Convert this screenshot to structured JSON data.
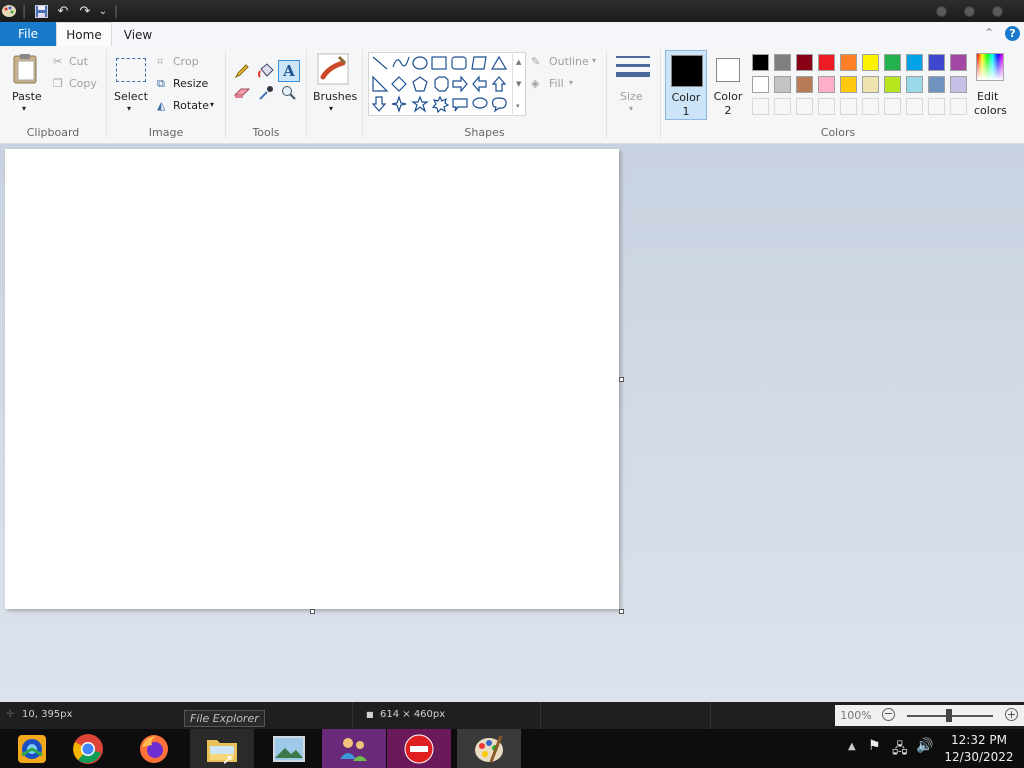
{
  "quick_access": {
    "undo_label": "↶",
    "redo_label": "↷",
    "more_label": "⌄"
  },
  "tabs": {
    "file": "File",
    "home": "Home",
    "view": "View"
  },
  "help_label": "?",
  "clipboard": {
    "paste": "Paste",
    "cut": "Cut",
    "copy": "Copy",
    "group": "Clipboard"
  },
  "image": {
    "select": "Select",
    "crop": "Crop",
    "resize": "Resize",
    "rotate": "Rotate",
    "group": "Image"
  },
  "tools": {
    "group": "Tools"
  },
  "brushes": {
    "label": "Brushes"
  },
  "shapes": {
    "group": "Shapes",
    "outline": "Outline",
    "fill": "Fill"
  },
  "size": {
    "label": "Size"
  },
  "colors": {
    "color1": "Color",
    "color1_num": "1",
    "color2": "Color",
    "color2_num": "2",
    "group": "Colors",
    "edit": "Edit",
    "edit2": "colors",
    "row1": [
      "#000000",
      "#7f7f7f",
      "#880015",
      "#ed1c24",
      "#ff7f27",
      "#fff200",
      "#22b14c",
      "#00a2e8",
      "#3f48cc",
      "#a349a4"
    ],
    "row2": [
      "#ffffff",
      "#c3c3c3",
      "#b97a57",
      "#ffaec9",
      "#ffc90e",
      "#efe4b0",
      "#b5e61d",
      "#99d9ea",
      "#7092be",
      "#c8bfe7"
    ]
  },
  "status": {
    "cursor": "10, 395px",
    "size": "614 × 460px",
    "zoom": "100%"
  },
  "tooltip": "File Explorer",
  "clock": {
    "time": "12:32 PM",
    "date": "12/30/2022"
  }
}
